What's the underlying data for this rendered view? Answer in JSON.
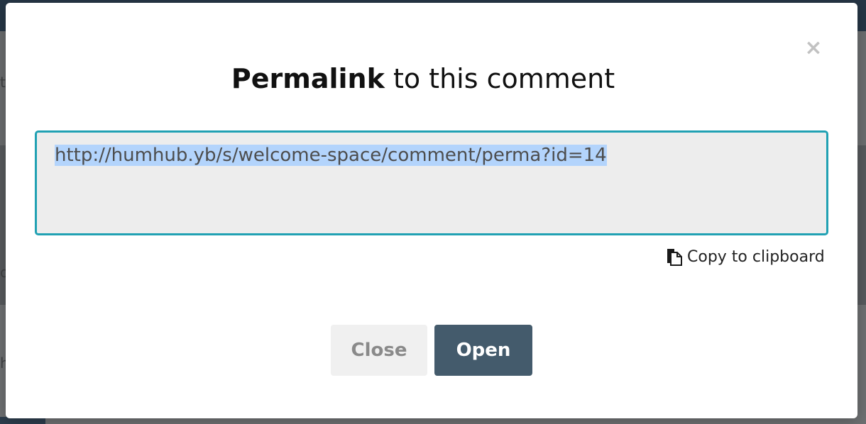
{
  "background": {
    "fragments": [
      "ts",
      "o",
      "h"
    ]
  },
  "modal": {
    "close_icon": "×",
    "title_bold": "Permalink",
    "title_rest": " to this comment",
    "permalink_value": "http://humhub.yb/s/welcome-space/comment/perma?id=14",
    "copy_label": "Copy to clipboard",
    "copy_icon": "clipboard-icon",
    "buttons": {
      "close_label": "Close",
      "open_label": "Open"
    }
  },
  "colors": {
    "accent": "#21a1b3",
    "primary_button": "#445b6c",
    "selection": "#b3d4fc"
  }
}
